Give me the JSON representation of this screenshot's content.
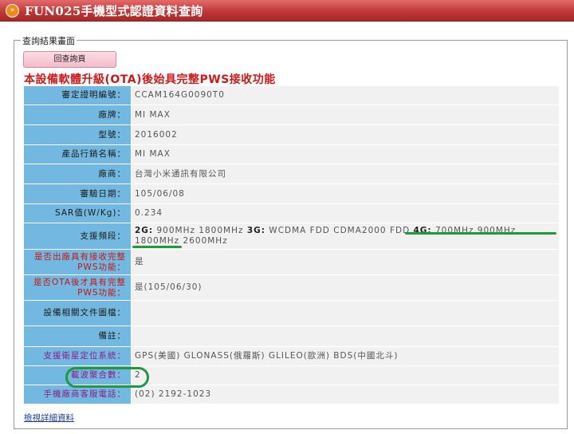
{
  "window": {
    "title": "FUN025手機型式認證資料查詢",
    "title_icon": "double-chevron-right-icon"
  },
  "form": {
    "legend": "查詢結果畫面",
    "back_button": "回查詢頁",
    "heading": "本設備軟體升級(OTA)後始具完整PWS接收功能",
    "detail_link": "檢視詳細資料"
  },
  "rows": [
    {
      "label": "審定證明編號：",
      "value": "CCAM164G0090T0"
    },
    {
      "label": "廠牌：",
      "value": "MI MAX"
    },
    {
      "label": "型號：",
      "value": "2016002"
    },
    {
      "label": "產品行銷名稱：",
      "value": "MI MAX"
    },
    {
      "label": "廠商：",
      "value": "台灣小米通訊有限公司"
    },
    {
      "label": "審驗日期：",
      "value": "105/06/08"
    },
    {
      "label": "SAR值(W/Kg)：",
      "value": "0.234"
    },
    {
      "label": "支援頻段：",
      "bands": {
        "g2_label": "2G:",
        "g2_value": " 900MHz 1800MHz ",
        "g3_label": "3G:",
        "g3_value": " WCDMA FDD CDMA2000 FDD ",
        "g4_label": "4G:",
        "g4_value": " 700MHz 900MHz 1800MHz 2600MHz"
      }
    },
    {
      "label": "是否出廠具有接收完整PWS功能：",
      "value": "是"
    },
    {
      "label": "是否OTA後才具有完整PWS功能：",
      "value": "是(105/06/30)"
    },
    {
      "label": "設備相關文件圖檔：",
      "value": ""
    },
    {
      "label": "備註：",
      "value": ""
    },
    {
      "label": "支援衛星定位系統：",
      "value": "GPS(美國) GLONASS(俄羅斯) GLILEO(歐洲) BDS(中國北斗)"
    },
    {
      "label": "載波聚合數：",
      "value": "2"
    },
    {
      "label": "手機廠商客服電話：",
      "value": "(02) 2192-1023"
    }
  ],
  "colors": {
    "titlebar": "#c13838",
    "label_bg": "#73b8e0",
    "value_bg": "#f1f1f1",
    "heading": "#d01818",
    "annotation": "#1e9a3c"
  }
}
